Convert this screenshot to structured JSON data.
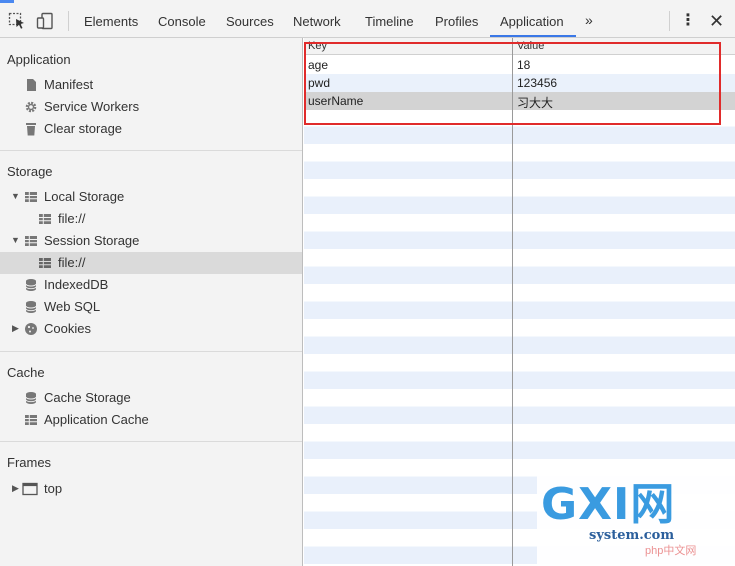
{
  "toolbar": {
    "tabs": [
      {
        "label": "Elements"
      },
      {
        "label": "Console"
      },
      {
        "label": "Sources"
      },
      {
        "label": "Network"
      },
      {
        "label": "Timeline"
      },
      {
        "label": "Profiles"
      },
      {
        "label": "Application"
      }
    ],
    "active_tab": "Application",
    "overflow_label": "»",
    "menu_label": "⋮",
    "close_label": "✕"
  },
  "sidebar": {
    "application": {
      "title": "Application",
      "items": [
        {
          "label": "Manifest",
          "icon": "document-icon"
        },
        {
          "label": "Service Workers",
          "icon": "gear-icon"
        },
        {
          "label": "Clear storage",
          "icon": "trash-icon"
        }
      ]
    },
    "storage": {
      "title": "Storage",
      "local_storage": {
        "label": "Local Storage",
        "children": [
          {
            "label": "file://"
          }
        ]
      },
      "session_storage": {
        "label": "Session Storage",
        "children": [
          {
            "label": "file://"
          }
        ]
      },
      "indexeddb": {
        "label": "IndexedDB"
      },
      "websql": {
        "label": "Web SQL"
      },
      "cookies": {
        "label": "Cookies"
      }
    },
    "cache": {
      "title": "Cache",
      "items": [
        {
          "label": "Cache Storage",
          "icon": "database-icon"
        },
        {
          "label": "Application Cache",
          "icon": "table-icon"
        }
      ]
    },
    "frames": {
      "title": "Frames",
      "items": [
        {
          "label": "top",
          "icon": "frame-icon"
        }
      ]
    },
    "selected_item": "Session Storage / file://"
  },
  "grid": {
    "columns": [
      "Key",
      "Value"
    ],
    "rows": [
      {
        "key": "age",
        "value": "18"
      },
      {
        "key": "pwd",
        "value": "123456"
      },
      {
        "key": "userName",
        "value": "习大大"
      }
    ],
    "selected_row": 2
  },
  "watermark": {
    "big": "GXI网",
    "small": "system.com",
    "tag": "php中文网"
  },
  "colors": {
    "accent": "#3b78e7",
    "highlight_box": "#e02b2b",
    "row_stripe": "#eaf1fb",
    "selection": "#d3d3d3"
  }
}
